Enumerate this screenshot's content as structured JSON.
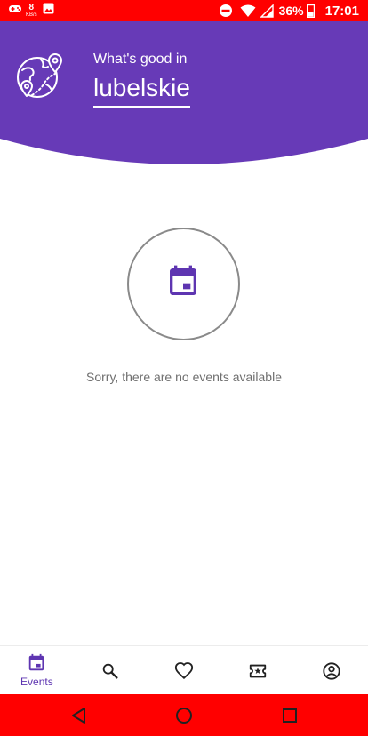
{
  "status_bar": {
    "net_speed_value": "8",
    "net_speed_unit": "KB/s",
    "battery_percent": "36%",
    "time": "17:01",
    "icons": [
      "gamepad-icon",
      "image-icon",
      "do-not-disturb-icon",
      "wifi-icon",
      "signal-icon",
      "battery-icon"
    ]
  },
  "header": {
    "subtitle": "What's good in",
    "region": "lubelskie",
    "logo_icon": "map-pin-globe-icon"
  },
  "empty_state": {
    "icon": "calendar-icon",
    "message": "Sorry, there are no events available"
  },
  "bottom_nav": {
    "items": [
      {
        "label": "Events",
        "icon": "calendar-icon",
        "active": true
      },
      {
        "label": "",
        "icon": "search-icon",
        "active": false
      },
      {
        "label": "",
        "icon": "heart-icon",
        "active": false
      },
      {
        "label": "",
        "icon": "ticket-star-icon",
        "active": false
      },
      {
        "label": "",
        "icon": "account-icon",
        "active": false
      }
    ]
  },
  "system_nav": {
    "icons": [
      "back-icon",
      "home-icon",
      "recents-icon"
    ]
  },
  "colors": {
    "status_bar": "#ff0000",
    "header_purple": "#673ab7",
    "accent": "#5e35b1",
    "icon_dark": "#212121",
    "muted_text": "#6f6f6f"
  }
}
